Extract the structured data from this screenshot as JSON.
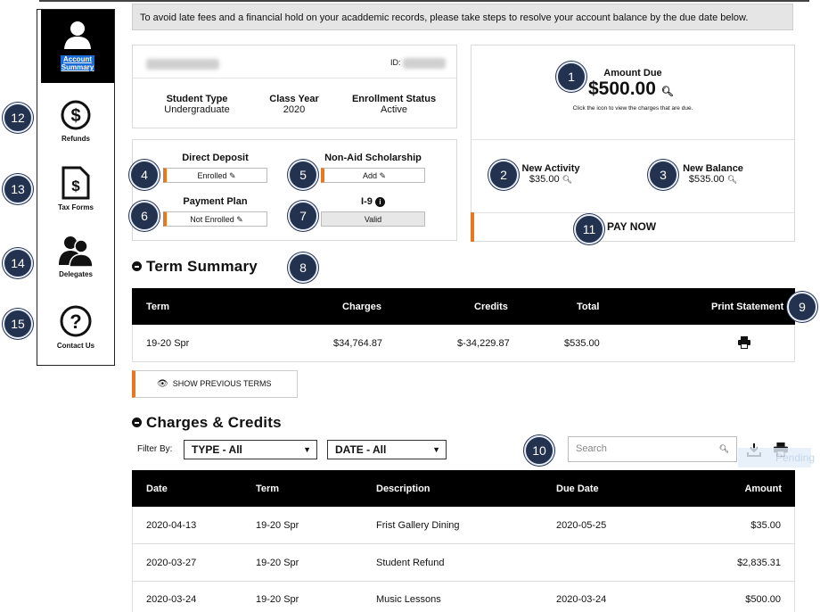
{
  "banner": "To avoid late fees and a financial hold on your acaddemic records, please take steps to resolve your account balance by the due date below.",
  "nav": {
    "account_summary": "Account Summary",
    "refunds": "Refunds",
    "tax_forms": "Tax Forms",
    "delegates": "Delegates",
    "contact_us": "Contact Us"
  },
  "callouts": [
    "1",
    "2",
    "3",
    "4",
    "5",
    "6",
    "7",
    "8",
    "9",
    "10",
    "11",
    "12",
    "13",
    "14",
    "15"
  ],
  "student": {
    "id_label": "ID:",
    "student_type_label": "Student Type",
    "student_type": "Undergraduate",
    "class_year_label": "Class Year",
    "class_year": "2020",
    "enrollment_status_label": "Enrollment Status",
    "enrollment_status": "Active"
  },
  "settings": {
    "direct_deposit_label": "Direct Deposit",
    "direct_deposit_value": "Enrolled",
    "non_aid_label": "Non-Aid Scholarship",
    "non_aid_value": "Add",
    "payment_plan_label": "Payment Plan",
    "payment_plan_value": "Not Enrolled",
    "i9_label": "I-9",
    "i9_value": "Valid"
  },
  "amount": {
    "due_label": "Amount Due",
    "due_value": "$500.00",
    "hint": "Click the icon to view the charges that are due.",
    "new_activity_label": "New Activity",
    "new_activity_value": "$35.00",
    "new_balance_label": "New Balance",
    "new_balance_value": "$535.00",
    "pay_now": "PAY NOW"
  },
  "term_summary": {
    "title": "Term Summary",
    "headers": [
      "Term",
      "Charges",
      "Credits",
      "Total",
      "Print Statement"
    ],
    "rows": [
      {
        "term": "19-20 Spr",
        "charges": "$34,764.87",
        "credits": "$-34,229.87",
        "total": "$535.00"
      }
    ],
    "show_previous": "SHOW PREVIOUS TERMS"
  },
  "charges": {
    "title": "Charges & Credits",
    "filter_label": "Filter By:",
    "type_select": "TYPE - All",
    "date_select": "DATE - All",
    "search_placeholder": "Search",
    "overlay_text": "Pending",
    "headers": [
      "Date",
      "Term",
      "Description",
      "Due Date",
      "Amount"
    ],
    "rows": [
      {
        "date": "2020-04-13",
        "term": "19-20 Spr",
        "desc": "Frist Gallery Dining",
        "due": "2020-05-25",
        "amount": "$35.00"
      },
      {
        "date": "2020-03-27",
        "term": "19-20 Spr",
        "desc": "Student Refund",
        "due": "",
        "amount": "$2,835.31"
      },
      {
        "date": "2020-03-24",
        "term": "19-20 Spr",
        "desc": "Music Lessons",
        "due": "2020-03-24",
        "amount": "$500.00"
      }
    ]
  },
  "colors": {
    "accent": "#e87722",
    "callout": "#23324f",
    "header": "#000000"
  }
}
